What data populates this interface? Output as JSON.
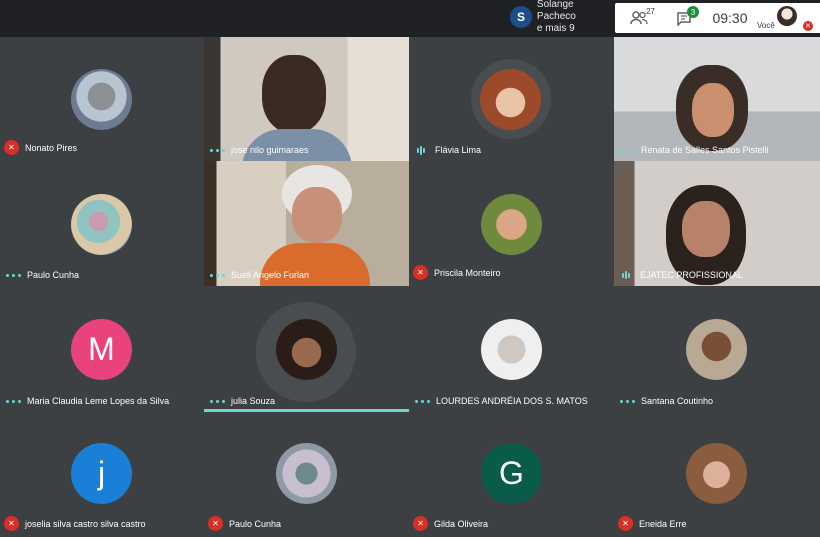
{
  "topbar": {
    "presenter_initial": "S",
    "presenter_name": "Solange Pacheco",
    "presenter_more": "e mais 9",
    "participants_count": "27",
    "chat_count": "3",
    "time": "09:30",
    "you_label": "Você"
  },
  "tiles": [
    {
      "name": "Nonato Pires",
      "status": "muted"
    },
    {
      "name": "jose nilo guimaraes",
      "status": "dots"
    },
    {
      "name": "Flávia Lima",
      "status": "speaking"
    },
    {
      "name": "Renata de Salles Santos Pistelli",
      "status": "dots"
    },
    {
      "name": "Paulo Cunha",
      "status": "dots"
    },
    {
      "name": "Sueli Angelo Furlan",
      "status": "dots"
    },
    {
      "name": "Priscila Monteiro",
      "status": "muted"
    },
    {
      "name": "EJATEC PROFISSIONAL",
      "status": "dots"
    },
    {
      "name": "Maria Claudia Leme Lopes da Silva",
      "status": "dots",
      "initial": "M",
      "color": "#e8437c"
    },
    {
      "name": "julia Souza",
      "status": "dots"
    },
    {
      "name": "LOURDES ANDRÉIA DOS S. MATOS",
      "status": "dots"
    },
    {
      "name": "Santana Coutinho",
      "status": "dots"
    },
    {
      "name": "joselia silva castro silva castro",
      "status": "muted",
      "initial": "j",
      "color": "#1a7fd6"
    },
    {
      "name": "Paulo Cunha",
      "status": "muted"
    },
    {
      "name": "Gilda Oliveira",
      "status": "muted",
      "initial": "G",
      "color": "#0b5b4a"
    },
    {
      "name": "Eneida Erre",
      "status": "muted"
    }
  ],
  "colors": {
    "background": "#202124",
    "tile": "#3c4043",
    "muted": "#d93025",
    "active": "#6dd5d0"
  },
  "icons": [
    "people-icon",
    "chat-icon",
    "mic-off-icon"
  ]
}
